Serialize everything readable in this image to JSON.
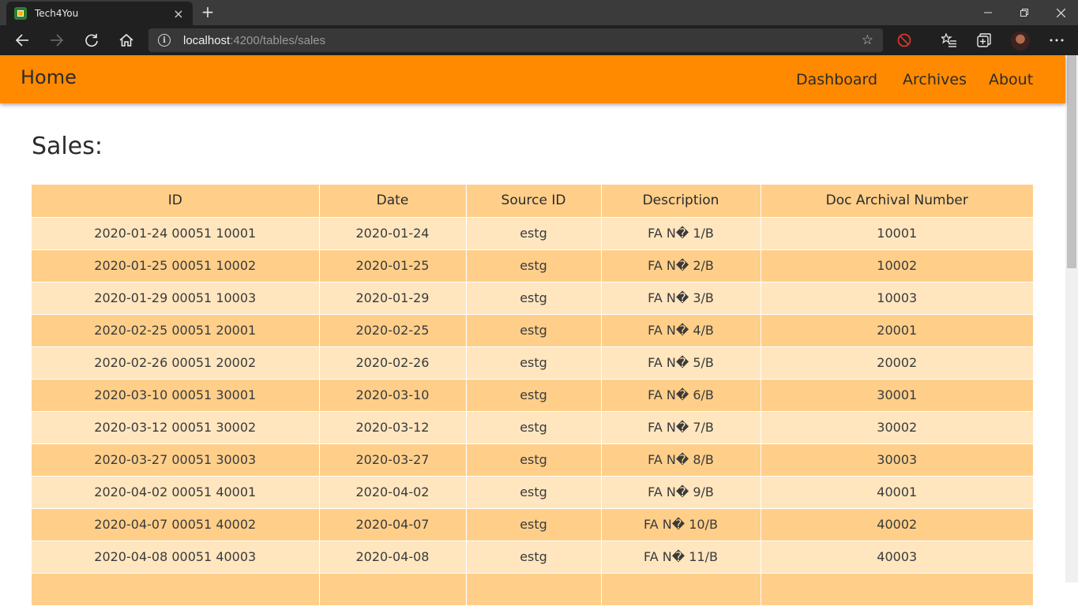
{
  "browser": {
    "tab_title": "Tech4You",
    "new_tab_symbol": "+",
    "url_host": "localhost",
    "url_path": ":4200/tables/sales"
  },
  "navbar": {
    "brand": "Home",
    "links": [
      "Dashboard",
      "Archives",
      "About"
    ]
  },
  "page": {
    "title": "Sales:"
  },
  "table": {
    "headers": [
      "ID",
      "Date",
      "Source ID",
      "Description",
      "Doc Archival Number"
    ],
    "rows": [
      [
        "2020-01-24 00051 10001",
        "2020-01-24",
        "estg",
        "FA N� 1/B",
        "10001"
      ],
      [
        "2020-01-25 00051 10002",
        "2020-01-25",
        "estg",
        "FA N� 2/B",
        "10002"
      ],
      [
        "2020-01-29 00051 10003",
        "2020-01-29",
        "estg",
        "FA N� 3/B",
        "10003"
      ],
      [
        "2020-02-25 00051 20001",
        "2020-02-25",
        "estg",
        "FA N� 4/B",
        "20001"
      ],
      [
        "2020-02-26 00051 20002",
        "2020-02-26",
        "estg",
        "FA N� 5/B",
        "20002"
      ],
      [
        "2020-03-10 00051 30001",
        "2020-03-10",
        "estg",
        "FA N� 6/B",
        "30001"
      ],
      [
        "2020-03-12 00051 30002",
        "2020-03-12",
        "estg",
        "FA N� 7/B",
        "30002"
      ],
      [
        "2020-03-27 00051 30003",
        "2020-03-27",
        "estg",
        "FA N� 8/B",
        "30003"
      ],
      [
        "2020-04-02 00051 40001",
        "2020-04-02",
        "estg",
        "FA N� 9/B",
        "40001"
      ],
      [
        "2020-04-07 00051 40002",
        "2020-04-07",
        "estg",
        "FA N� 10/B",
        "40002"
      ],
      [
        "2020-04-08 00051 40003",
        "2020-04-08",
        "estg",
        "FA N� 11/B",
        "40003"
      ],
      [
        "",
        "",
        "",
        "",
        ""
      ]
    ]
  },
  "colors": {
    "navbar": "#ff8a00",
    "row_light": "#ffe6bf",
    "row_dark": "#ffcf8a"
  }
}
